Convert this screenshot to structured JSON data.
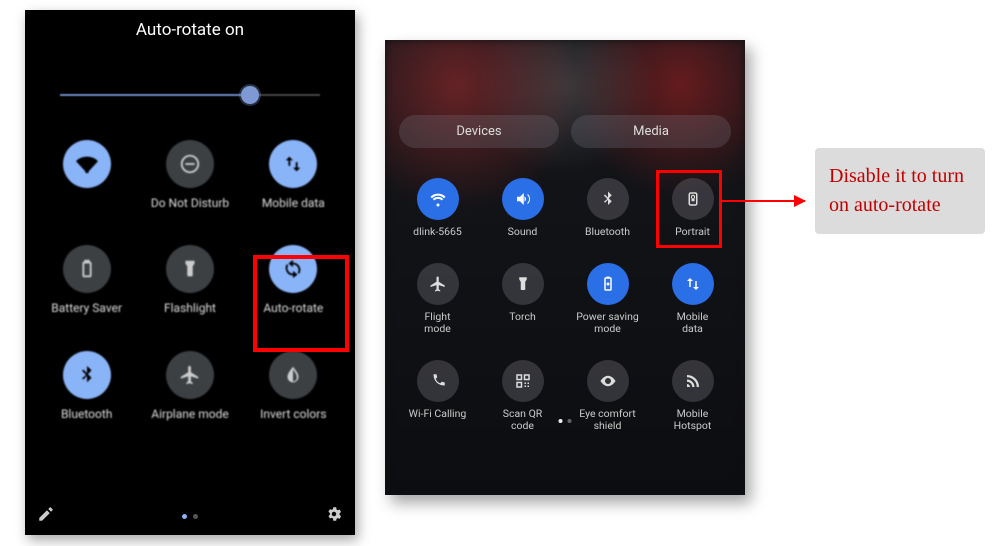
{
  "panel1": {
    "title": "Auto-rotate on",
    "brightness_percent": 73,
    "tiles": [
      {
        "name": "wifi",
        "label": "",
        "active": true
      },
      {
        "name": "dnd",
        "label": "Do Not Disturb",
        "active": false
      },
      {
        "name": "mobile-data",
        "label": "Mobile data",
        "active": true
      },
      {
        "name": "battery-saver",
        "label": "Battery Saver",
        "active": false
      },
      {
        "name": "flashlight",
        "label": "Flashlight",
        "active": false
      },
      {
        "name": "auto-rotate",
        "label": "Auto-rotate",
        "active": true,
        "highlighted": true
      },
      {
        "name": "bluetooth",
        "label": "Bluetooth",
        "active": true
      },
      {
        "name": "airplane",
        "label": "Airplane mode",
        "active": false
      },
      {
        "name": "invert-colors",
        "label": "Invert colors",
        "active": false
      }
    ],
    "page_count": 2,
    "active_page": 0
  },
  "panel2": {
    "top_buttons": [
      "Devices",
      "Media"
    ],
    "tiles": [
      {
        "name": "wifi",
        "label": "dlink-5665",
        "active": true
      },
      {
        "name": "sound",
        "label": "Sound",
        "active": true
      },
      {
        "name": "bluetooth",
        "label": "Bluetooth",
        "active": false
      },
      {
        "name": "portrait",
        "label": "Portrait",
        "active": false,
        "highlighted": true
      },
      {
        "name": "flight-mode",
        "label": "Flight\nmode",
        "active": false
      },
      {
        "name": "torch",
        "label": "Torch",
        "active": false
      },
      {
        "name": "power-saving",
        "label": "Power saving\nmode",
        "active": true
      },
      {
        "name": "mobile-data",
        "label": "Mobile\ndata",
        "active": true
      },
      {
        "name": "wifi-calling",
        "label": "Wi-Fi Calling",
        "active": false
      },
      {
        "name": "scan-qr",
        "label": "Scan QR\ncode",
        "active": false
      },
      {
        "name": "eye-comfort",
        "label": "Eye comfort\nshield",
        "active": false
      },
      {
        "name": "mobile-hotspot",
        "label": "Mobile\nHotspot",
        "active": false
      }
    ],
    "page_count": 2,
    "active_page": 0
  },
  "callout": {
    "text": "Disable it to turn on auto-rotate"
  }
}
